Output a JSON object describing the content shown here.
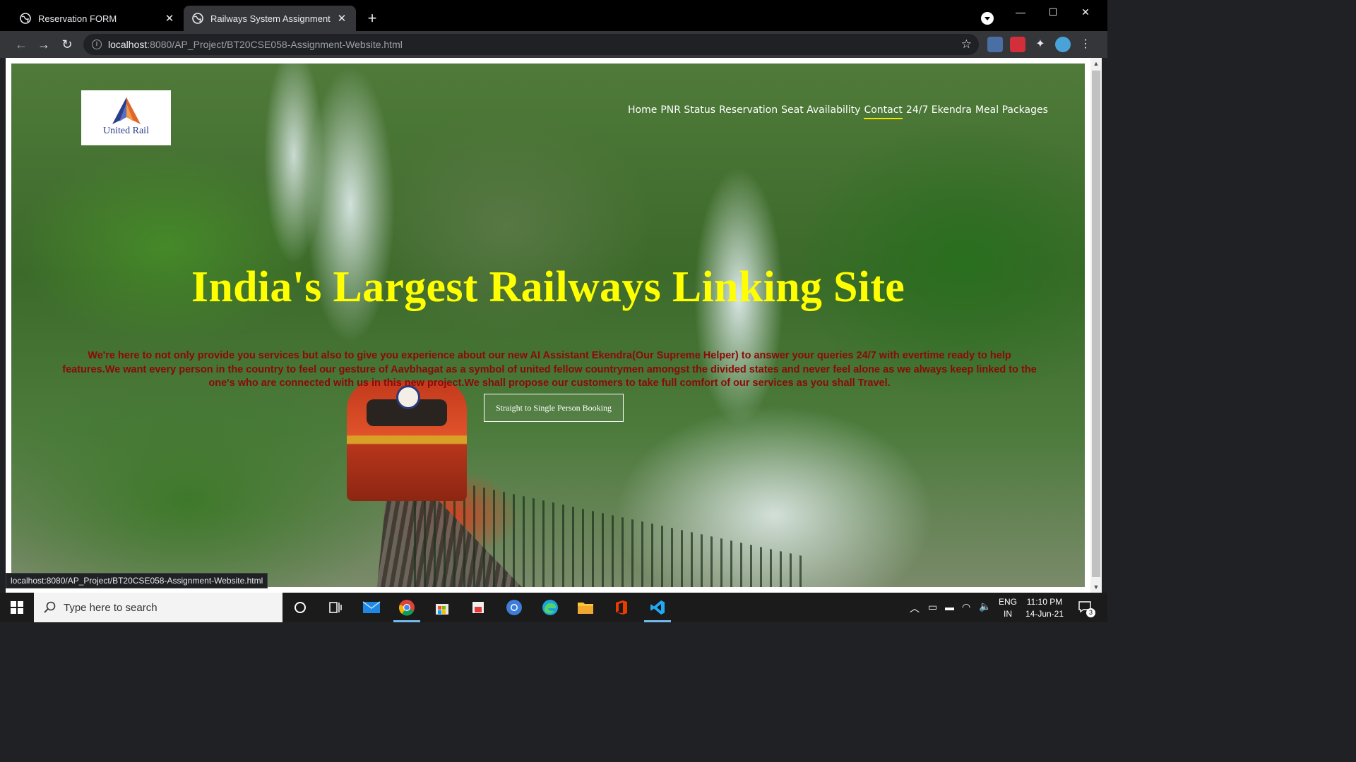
{
  "browser": {
    "tabs": [
      {
        "title": "Reservation FORM",
        "active": false
      },
      {
        "title": "Railways System Assignment",
        "active": true
      }
    ],
    "url_host": "localhost",
    "url_path": ":8080/AP_Project/BT20CSE058-Assignment-Website.html",
    "status_url": "localhost:8080/AP_Project/BT20CSE058-Assignment-Website.html"
  },
  "page": {
    "logo_text": "United Rail",
    "nav": [
      {
        "label": "Home"
      },
      {
        "label": "PNR Status"
      },
      {
        "label": "Reservation"
      },
      {
        "label": "Seat Availability"
      },
      {
        "label": "Contact",
        "active": true
      },
      {
        "label": "24/7 Ekendra"
      },
      {
        "label": "Meal Packages"
      }
    ],
    "headline": "India's Largest Railways Linking Site",
    "description": "We're here to not only provide you services but also to give you experience about our new AI Assistant Ekendra(Our Supreme Helper) to answer your queries 24/7 with evertime ready to help features.We want every person in the country to feel our gesture of Aavbhagat as a symbol of united fellow countrymen amongst the divided states and never feel alone as we always keep linked to the one's who are connected with us in this new project.We shall propose our customers to take full comfort of our services as you shall Travel.",
    "cta_label": "Straight to Single Person Booking",
    "colors": {
      "headline": "#ffff00",
      "description": "#8a0a0a",
      "nav_underline": "#f2e600"
    }
  },
  "taskbar": {
    "search_placeholder": "Type here to search",
    "lang_top": "ENG",
    "lang_bottom": "IN",
    "time": "11:10 PM",
    "date": "14-Jun-21",
    "notification_count": "3"
  }
}
